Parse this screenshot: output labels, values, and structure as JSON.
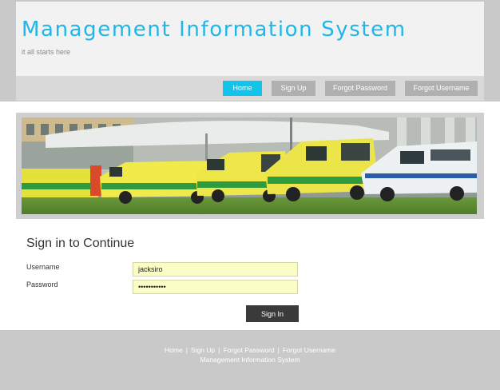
{
  "header": {
    "title": "Management Information System",
    "tagline": "it all starts here"
  },
  "nav": {
    "items": [
      {
        "label": "Home",
        "active": true
      },
      {
        "label": "Sign Up",
        "active": false
      },
      {
        "label": "Forgot Password",
        "active": false
      },
      {
        "label": "Forgot Username",
        "active": false
      }
    ]
  },
  "banner": {
    "icon": "ambulance-fleet-photo"
  },
  "form": {
    "heading": "Sign in to Continue",
    "username_label": "Username",
    "username_value": "jacksiro",
    "password_label": "Password",
    "password_value": "•••••••••••",
    "submit_label": "Sign In"
  },
  "footer": {
    "links": [
      "Home",
      "Sign Up",
      "Forgot Password",
      "Forgot Username"
    ],
    "separator": "|",
    "site_name": "Management Information System"
  },
  "colors": {
    "accent": "#11c4ec",
    "title": "#1fb6e8",
    "nav_button": "#b0b0b0",
    "input_bg": "#fbfdc7",
    "submit_bg": "#3a3a3a",
    "band": "#c9c9c9"
  }
}
